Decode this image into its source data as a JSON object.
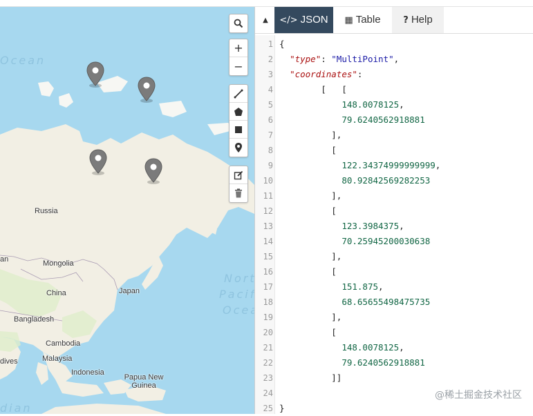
{
  "map": {
    "ocean_labels": [
      "Ocean",
      "North",
      "Pacific",
      "Ocean",
      "dian"
    ],
    "places": [
      "Russia",
      "Mongolia",
      "China",
      "Japan",
      "Bangladesh",
      "Cambodia",
      "Malaysia",
      "Indonesia",
      "Papua New Guinea",
      "dives",
      "an"
    ],
    "markers": [
      {
        "lon": 148.0078125,
        "lat": 79.6240562918881
      },
      {
        "lon": 122.34374999999999,
        "lat": 80.92842569282253
      },
      {
        "lon": 123.3984375,
        "lat": 70.25945200030638
      },
      {
        "lon": 151.875,
        "lat": 68.65655498475735
      }
    ],
    "controls": [
      "search-icon",
      "zoom-in",
      "zoom-out",
      "draw-line-icon",
      "draw-polygon-icon",
      "draw-rectangle-icon",
      "draw-marker-icon",
      "edit-icon",
      "delete-icon"
    ],
    "zoom_in_label": "+",
    "zoom_out_label": "−"
  },
  "tabs": {
    "collapse_icon": "▲",
    "items": [
      {
        "icon": "</>",
        "label": "JSON"
      },
      {
        "icon": "▦",
        "label": "Table"
      },
      {
        "icon": "?",
        "label": "Help"
      }
    ]
  },
  "editor": {
    "line_numbers": [
      "1",
      "2",
      "3",
      "4",
      "5",
      "6",
      "7",
      "8",
      "9",
      "10",
      "11",
      "12",
      "13",
      "14",
      "15",
      "16",
      "17",
      "18",
      "19",
      "20",
      "21",
      "22",
      "23",
      "24",
      "25"
    ],
    "lines": [
      "{",
      "  \"type\": \"MultiPoint\",",
      "  \"coordinates\":",
      "        [   [",
      "            148.0078125,",
      "            79.6240562918881",
      "          ],",
      "          [",
      "            122.34374999999999,",
      "            80.92842569282253",
      "          ],",
      "          [",
      "            123.3984375,",
      "            70.25945200030638",
      "          ],",
      "          [",
      "            151.875,",
      "            68.65655498475735",
      "          ],",
      "          [",
      "            148.0078125,",
      "            79.6240562918881",
      "          ]]",
      "",
      "}"
    ]
  },
  "watermark": "@稀土掘金技术社区",
  "colors": {
    "tab_active_bg": "#34495e",
    "water": "#a7d8ef",
    "land": "#f2efe4",
    "marker": "#777777"
  }
}
